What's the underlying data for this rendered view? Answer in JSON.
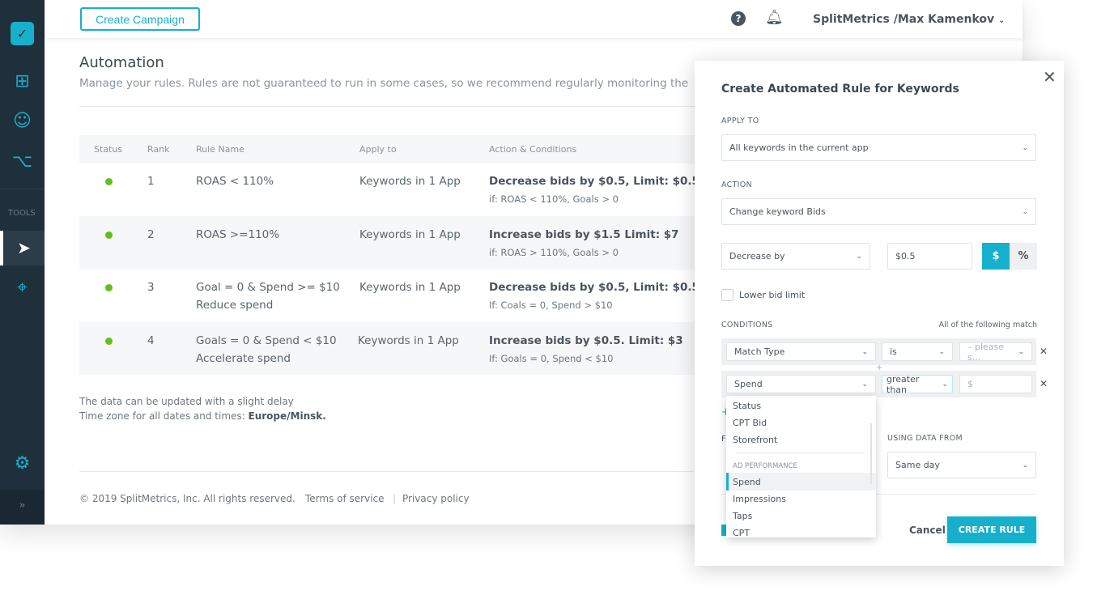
{
  "topbar": {
    "create_campaign": "Create Campaign",
    "account": "SplitMetrics /Max Kamenkov"
  },
  "sidebar": {
    "tools_label": "TOOLS",
    "expand": "»"
  },
  "page": {
    "title": "Automation",
    "subtitle": "Manage your rules. Rules are not guaranteed to run in some cases, so we recommend regularly monitoring the"
  },
  "table": {
    "headers": [
      "Status",
      "Rank",
      "Rule Name",
      "Apply to",
      "Action & Conditions"
    ],
    "rows": [
      {
        "rank": "1",
        "name": "ROAS < 110%",
        "name2": "",
        "apply": "Keywords in 1 App",
        "action": "Decrease bids by $0.5, Limit: $0.5",
        "cond": "if: ROAS < 110%, Goals > 0"
      },
      {
        "rank": "2",
        "name": "ROAS >=110%",
        "name2": "",
        "apply": "Keywords in 1 App",
        "action": "Increase bids by $1.5 Limit: $7",
        "cond": "if: ROAS > 110%, Goals > 0"
      },
      {
        "rank": "3",
        "name": "Goal = 0 & Spend >= $10",
        "name2": "Reduce spend",
        "apply": "Keywords in 1 App",
        "action": "Decrease bids by $0.5, Limit: $0.5",
        "cond": "If: Coals = 0, Spend > $10"
      },
      {
        "rank": "4",
        "name": "Goals = 0 & Spend < $10",
        "name2": "Accelerate spend",
        "apply": "Keywords in 1 App",
        "action": "Increase bids by $0.5. Limit: $3",
        "cond": "If: Goals = 0, Spend < $10"
      }
    ]
  },
  "notes": {
    "line1": "The data can be updated with a slight delay",
    "line2_prefix": "Time zone for all dates and times: ",
    "timezone": "Europe/Minsk."
  },
  "footer": {
    "copyright": "© 2019 SplitMetrics, Inc. All rights reserved.",
    "terms": "Terms of service",
    "privacy": "Privacy policy"
  },
  "modal": {
    "title": "Create Automated Rule for Keywords",
    "apply_to_label": "APPLY TO",
    "apply_to_value": "All keywords in the current app",
    "action_label": "ACTION",
    "action_value": "Change keyword Bids",
    "direction": "Decrease by",
    "amount": "$0.5",
    "unit_dollar": "$",
    "unit_percent": "%",
    "lower_limit": "Lower bid limit",
    "conditions_label": "CONDITIONS",
    "match_mode": "All of the following match",
    "cond1": {
      "field": "Match Type",
      "op": "is",
      "value": "– please s..."
    },
    "cond2": {
      "field": "Spend",
      "op": "greater than",
      "placeholder": "$"
    },
    "dropdown": {
      "items": [
        "Status",
        "CPT Bid",
        "Storefront"
      ],
      "group": "AD PERFORMANCE",
      "group_items": [
        "Spend",
        "Impressions",
        "Taps",
        "CPT"
      ],
      "selected": "Spend"
    },
    "using_data_label": "USING DATA FROM",
    "using_data_value": "Same day",
    "cancel": "Cancel",
    "create": "CREATE RULE"
  },
  "colors": {
    "accent": "#17b0cc",
    "sidebar": "#1f2f3b",
    "active": "#5fc118"
  }
}
